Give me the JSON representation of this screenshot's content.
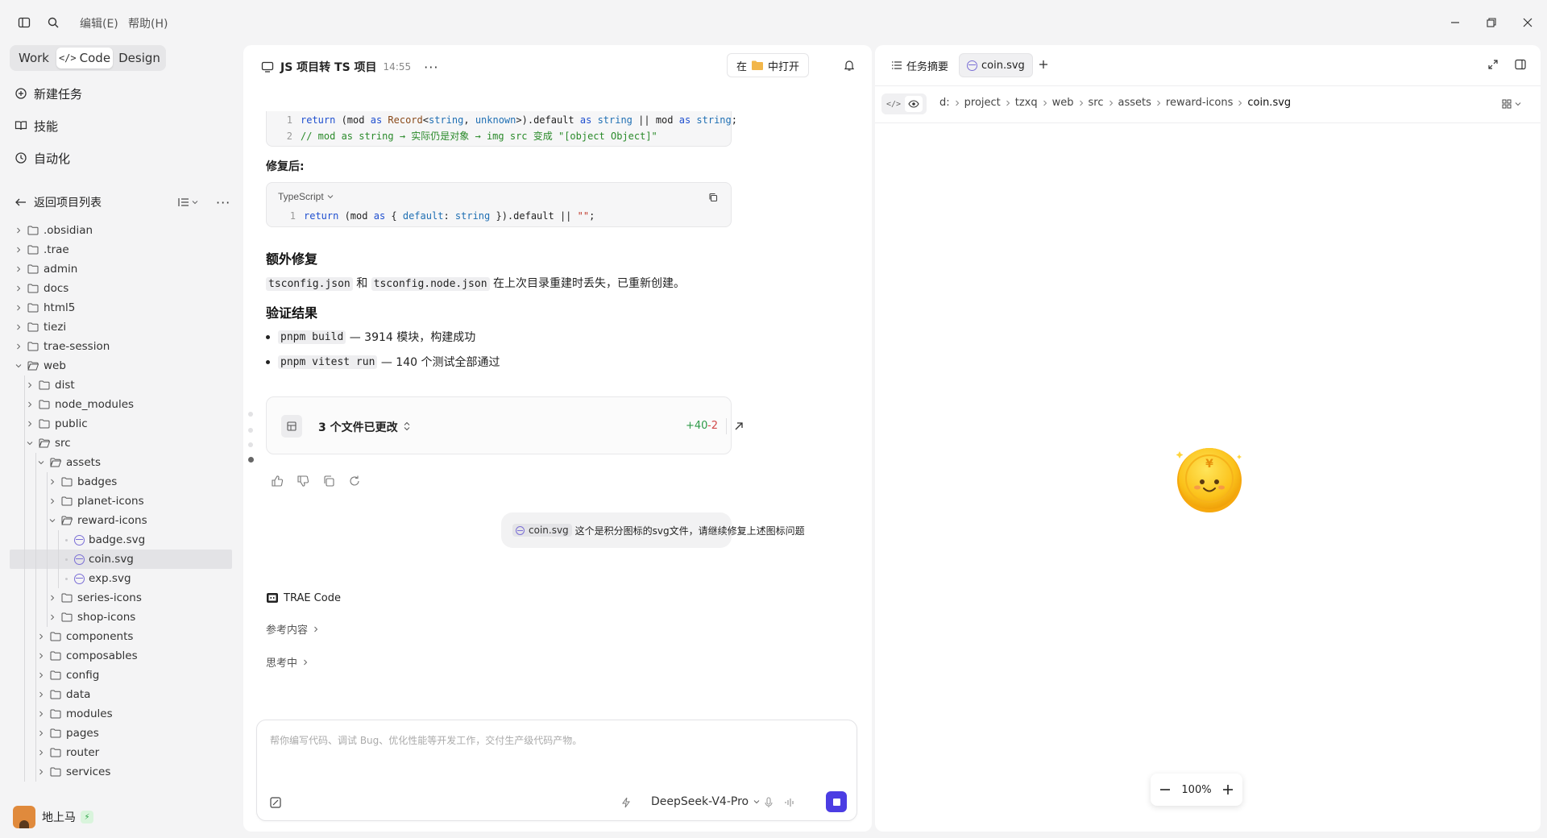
{
  "titlebar": {
    "menus": [
      "编辑(E)",
      "帮助(H)"
    ]
  },
  "sidebar": {
    "modes": [
      "Work",
      "Code",
      "Design"
    ],
    "active_mode": "Code",
    "nav": [
      {
        "label": "新建任务",
        "icon": "new-task-icon"
      },
      {
        "label": "技能",
        "icon": "book-icon"
      },
      {
        "label": "自动化",
        "icon": "clock-icon"
      }
    ],
    "back_label": "返回项目列表",
    "tree": [
      {
        "label": ".obsidian",
        "type": "folder",
        "depth": 0,
        "open": false
      },
      {
        "label": ".trae",
        "type": "folder",
        "depth": 0,
        "open": false
      },
      {
        "label": "admin",
        "type": "folder",
        "depth": 0,
        "open": false
      },
      {
        "label": "docs",
        "type": "folder",
        "depth": 0,
        "open": false
      },
      {
        "label": "html5",
        "type": "folder",
        "depth": 0,
        "open": false
      },
      {
        "label": "tiezi",
        "type": "folder",
        "depth": 0,
        "open": false
      },
      {
        "label": "trae-session",
        "type": "folder",
        "depth": 0,
        "open": false
      },
      {
        "label": "web",
        "type": "folder",
        "depth": 0,
        "open": true
      },
      {
        "label": "dist",
        "type": "folder",
        "depth": 1,
        "open": false
      },
      {
        "label": "node_modules",
        "type": "folder",
        "depth": 1,
        "open": false
      },
      {
        "label": "public",
        "type": "folder",
        "depth": 1,
        "open": false
      },
      {
        "label": "src",
        "type": "folder",
        "depth": 1,
        "open": true
      },
      {
        "label": "assets",
        "type": "folder",
        "depth": 2,
        "open": true
      },
      {
        "label": "badges",
        "type": "folder",
        "depth": 3,
        "open": false
      },
      {
        "label": "planet-icons",
        "type": "folder",
        "depth": 3,
        "open": false
      },
      {
        "label": "reward-icons",
        "type": "folder",
        "depth": 3,
        "open": true
      },
      {
        "label": "badge.svg",
        "type": "svg",
        "depth": 4
      },
      {
        "label": "coin.svg",
        "type": "svg",
        "depth": 4,
        "selected": true
      },
      {
        "label": "exp.svg",
        "type": "svg",
        "depth": 4
      },
      {
        "label": "series-icons",
        "type": "folder",
        "depth": 3,
        "open": false
      },
      {
        "label": "shop-icons",
        "type": "folder",
        "depth": 3,
        "open": false
      },
      {
        "label": "components",
        "type": "folder",
        "depth": 2,
        "open": false
      },
      {
        "label": "composables",
        "type": "folder",
        "depth": 2,
        "open": false
      },
      {
        "label": "config",
        "type": "folder",
        "depth": 2,
        "open": false
      },
      {
        "label": "data",
        "type": "folder",
        "depth": 2,
        "open": false
      },
      {
        "label": "modules",
        "type": "folder",
        "depth": 2,
        "open": false
      },
      {
        "label": "pages",
        "type": "folder",
        "depth": 2,
        "open": false
      },
      {
        "label": "router",
        "type": "folder",
        "depth": 2,
        "open": false
      },
      {
        "label": "services",
        "type": "folder",
        "depth": 2,
        "open": false
      }
    ],
    "user": {
      "name": "地上马"
    }
  },
  "chat": {
    "title": "JS 项目转 TS 项目",
    "time": "14:55",
    "open_in": {
      "prefix": "在",
      "suffix": "中打开"
    },
    "code1": [
      "return (mod as Record<string, unknown>).default as string || mod as string;",
      "// mod as string → 实际仍是对象 → img src 变成 \"[object Object]\""
    ],
    "fixed_heading": "修复后:",
    "code2": {
      "lang": "TypeScript",
      "line": "return (mod as { default: string }).default || \"\";"
    },
    "extra_heading": "额外修复",
    "extra_text": {
      "code_a": "tsconfig.json",
      "joiner": "和",
      "code_b": "tsconfig.node.json",
      "rest": "在上次目录重建时丢失，已重新创建。"
    },
    "verify_heading": "验证结果",
    "bullets": [
      {
        "code": "pnpm build",
        "text": "— 3914 模块，构建成功"
      },
      {
        "code": "pnpm vitest run",
        "text": "— 140 个测试全部通过"
      }
    ],
    "changes": {
      "label": "3 个文件已更改",
      "added": "+40",
      "removed": "-2"
    },
    "user_msg": {
      "chip": "coin.svg",
      "text": "这个是积分图标的svg文件，请继续修复上述图标问题"
    },
    "agent_name": "TRAE Code",
    "reference_label": "参考内容",
    "thinking_label": "思考中",
    "input_placeholder": "帮你编写代码、调试 Bug、优化性能等开发工作，交付生产级代码产物。",
    "model": "DeepSeek-V4-Pro"
  },
  "preview": {
    "tabs": [
      "任务摘要",
      "coin.svg"
    ],
    "active_tab": "coin.svg",
    "breadcrumb": [
      "d:",
      "project",
      "tzxq",
      "web",
      "src",
      "assets",
      "reward-icons",
      "coin.svg"
    ],
    "zoom": "100%",
    "coin_symbol": "¥"
  }
}
